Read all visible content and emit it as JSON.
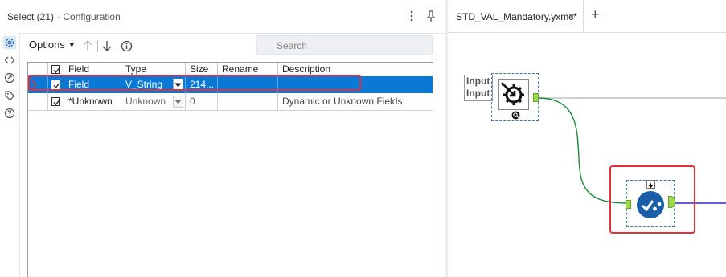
{
  "config_panel": {
    "title": "Select (21)",
    "subtitle": "- Configuration",
    "header_icons": [
      "more-vertical-icon",
      "pin-icon"
    ],
    "side_icons": [
      "gear-icon",
      "code-icon",
      "arrows-icon",
      "tag-icon",
      "help-icon"
    ],
    "toolbar": {
      "options_label": "Options",
      "search_placeholder": "Search",
      "icons": [
        "arrow-up-icon",
        "arrow-down-icon",
        "info-icon"
      ]
    },
    "grid": {
      "columns": [
        "Field",
        "Type",
        "Size",
        "Rename",
        "Description"
      ],
      "rows": [
        {
          "checked": true,
          "field": "Field",
          "type": "V_String",
          "size": "214...",
          "rename": "",
          "description": "",
          "selected": true
        },
        {
          "checked": true,
          "field": "*Unknown",
          "type": "Unknown",
          "size": "0",
          "rename": "",
          "description": "Dynamic or Unknown Fields",
          "selected": false
        }
      ]
    }
  },
  "canvas": {
    "tab": {
      "label": "STD_VAL_Mandatory.yxmc*",
      "close": "×",
      "add": "+"
    },
    "input_anchor": {
      "line1": "Input",
      "line2": "Input"
    },
    "colors": {
      "accent": "#0a79d6",
      "highlight": "#e0313a",
      "connection_green": "#1d8a3c",
      "connection_blue": "#2c2cc8",
      "anchor_green": "#9bd84b",
      "tool_blue": "#1a5ea8"
    }
  }
}
